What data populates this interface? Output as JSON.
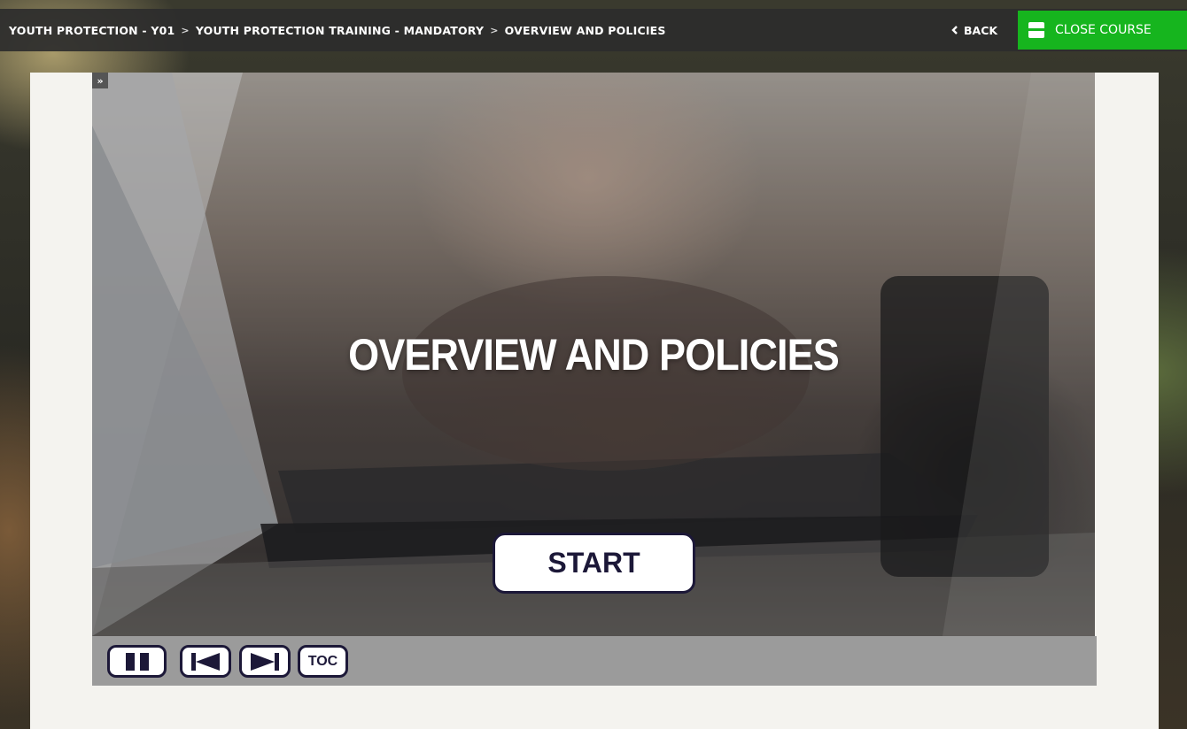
{
  "header": {
    "breadcrumb": [
      "YOUTH PROTECTION - Y01",
      "YOUTH PROTECTION TRAINING - MANDATORY",
      "OVERVIEW AND POLICIES"
    ],
    "breadcrumb_separator": ">",
    "back_label": "BACK",
    "close_course_label": "CLOSE COURSE"
  },
  "sidebar_toggle_label": "»",
  "slide": {
    "title": "OVERVIEW AND POLICIES",
    "start_label": "START"
  },
  "controls": {
    "toc_label": "TOC",
    "pause_icon": "pause-icon",
    "prev_icon": "skip-back-icon",
    "next_icon": "skip-forward-icon"
  },
  "colors": {
    "close_course_bg": "#16b51e",
    "button_border": "#1c1838",
    "control_bar_bg": "#9b9b9b",
    "frame_bg": "#f4f3ef"
  }
}
